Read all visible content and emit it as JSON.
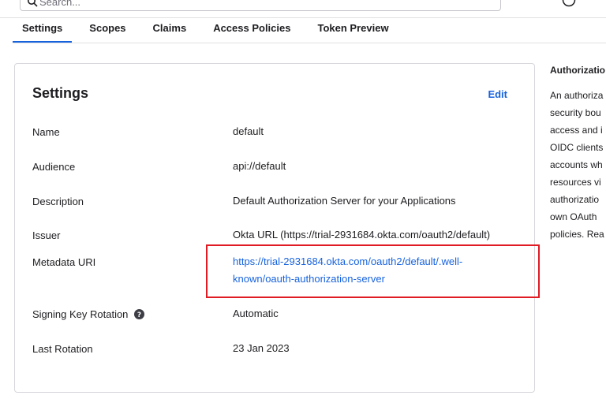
{
  "search": {
    "placeholder": "Search..."
  },
  "tabs": [
    {
      "label": "Settings",
      "active": true
    },
    {
      "label": "Scopes"
    },
    {
      "label": "Claims"
    },
    {
      "label": "Access Policies"
    },
    {
      "label": "Token Preview"
    }
  ],
  "card": {
    "title": "Settings",
    "edit_label": "Edit",
    "rows": [
      {
        "label": "Name",
        "value": "default"
      },
      {
        "label": "Audience",
        "value": "api://default"
      },
      {
        "label": "Description",
        "value": "Default Authorization Server for your Applications"
      },
      {
        "label": "Issuer",
        "value": "Okta URL (https://trial-2931684.okta.com/oauth2/default)"
      },
      {
        "label": "Metadata URI",
        "value_line1": "https://trial-2931684.okta.com/oauth2/default/.well-",
        "value_line2": "known/oauth-authorization-server"
      },
      {
        "label": "Signing Key Rotation",
        "value": "Automatic"
      },
      {
        "label": "Last Rotation",
        "value": "23 Jan 2023"
      }
    ]
  },
  "sidebar": {
    "title": "Authorizatio",
    "lines": [
      "An authoriza",
      "security bou",
      "access and i",
      "OIDC clients",
      "accounts wh",
      "resources vi",
      "authorizatio",
      "own OAuth",
      "policies. Rea"
    ]
  },
  "colors": {
    "accent": "#1662dd",
    "highlight": "#e01b24"
  }
}
